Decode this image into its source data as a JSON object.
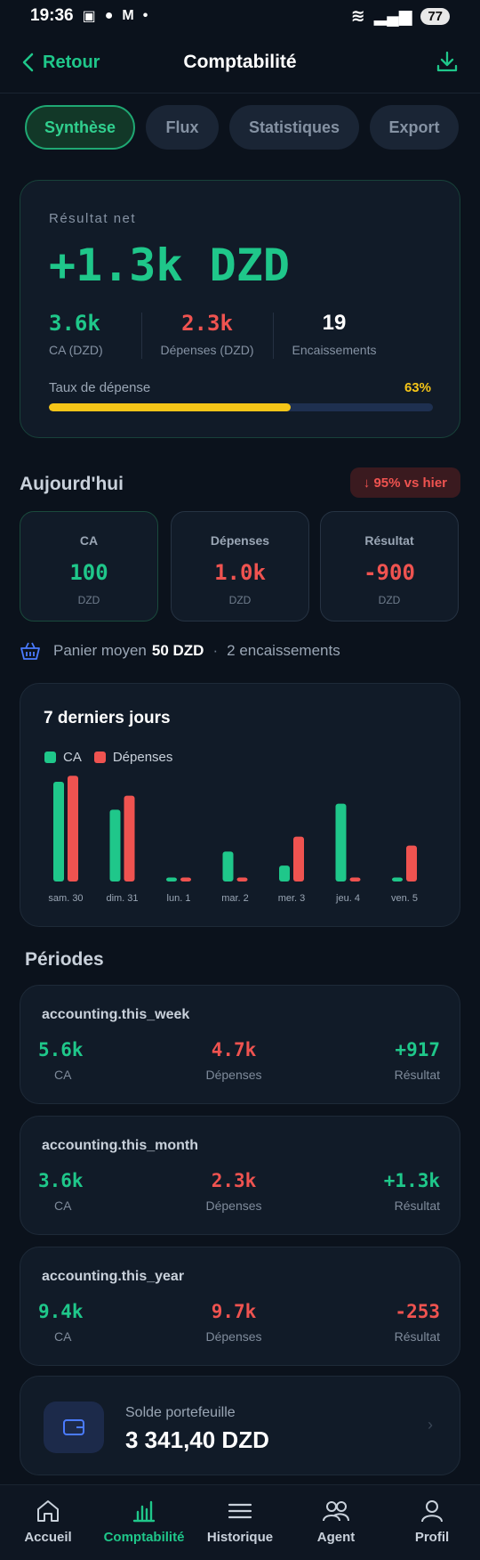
{
  "status_bar": {
    "time": "19:36",
    "battery": "77"
  },
  "header": {
    "back_label": "Retour",
    "title": "Comptabilité"
  },
  "tabs": [
    {
      "label": "Synthèse",
      "active": true
    },
    {
      "label": "Flux",
      "active": false
    },
    {
      "label": "Statistiques",
      "active": false
    },
    {
      "label": "Export",
      "active": false
    }
  ],
  "summary": {
    "label": "Résultat net",
    "value": "+1.3k DZD",
    "ca_value": "3.6k",
    "ca_label": "CA (DZD)",
    "dep_value": "2.3k",
    "dep_label": "Dépenses (DZD)",
    "enc_value": "19",
    "enc_label": "Encaissements",
    "rate_label": "Taux de dépense",
    "rate_value": "63%",
    "rate_fraction": 0.63
  },
  "today": {
    "title": "Aujourd'hui",
    "badge": "↓ 95% vs hier",
    "cards": [
      {
        "title": "CA",
        "value": "100",
        "unit": "DZD"
      },
      {
        "title": "Dépenses",
        "value": "1.0k",
        "unit": "DZD"
      },
      {
        "title": "Résultat",
        "value": "-900",
        "unit": "DZD"
      }
    ],
    "basket_label": "Panier moyen",
    "basket_value": "50 DZD",
    "basket_sep": "·",
    "encaissements": "2 encaissements"
  },
  "chart_data": {
    "type": "bar",
    "title": "7 derniers jours",
    "categories": [
      "sam. 30",
      "dim. 31",
      "lun. 1",
      "mar. 2",
      "mer. 3",
      "jeu. 4",
      "ven. 5"
    ],
    "series": [
      {
        "name": "CA",
        "color": "#1fc78a",
        "values": [
          1.0,
          0.72,
          0.04,
          0.3,
          0.16,
          0.78,
          0.04
        ]
      },
      {
        "name": "Dépenses",
        "color": "#ef5350",
        "values": [
          1.06,
          0.86,
          0.04,
          0.04,
          0.45,
          0.04,
          0.36
        ]
      }
    ]
  },
  "periods": {
    "title": "Périodes",
    "items": [
      {
        "label": "accounting.this_week",
        "ca": "5.6k",
        "dep": "4.7k",
        "res": "+917",
        "res_positive": true
      },
      {
        "label": "accounting.this_month",
        "ca": "3.6k",
        "dep": "2.3k",
        "res": "+1.3k",
        "res_positive": true
      },
      {
        "label": "accounting.this_year",
        "ca": "9.4k",
        "dep": "9.7k",
        "res": "-253",
        "res_positive": false
      }
    ],
    "ca_label": "CA",
    "dep_label": "Dépenses",
    "res_label": "Résultat"
  },
  "wallet": {
    "label": "Solde portefeuille",
    "value": "3 341,40 DZD"
  },
  "nav": [
    {
      "label": "Accueil",
      "icon": "home-icon",
      "active": false
    },
    {
      "label": "Comptabilité",
      "icon": "chart-icon",
      "active": true
    },
    {
      "label": "Historique",
      "icon": "menu-icon",
      "active": false
    },
    {
      "label": "Agent",
      "icon": "users-icon",
      "active": false
    },
    {
      "label": "Profil",
      "icon": "user-icon",
      "active": false
    }
  ]
}
